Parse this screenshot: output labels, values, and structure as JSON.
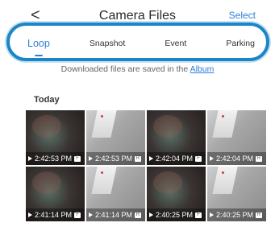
{
  "header": {
    "back_glyph": "<",
    "title": "Camera Files",
    "select_label": "Select"
  },
  "tabs": [
    {
      "label": "Loop",
      "active": true
    },
    {
      "label": "Snapshot",
      "active": false
    },
    {
      "label": "Event",
      "active": false
    },
    {
      "label": "Parking",
      "active": false
    }
  ],
  "info": {
    "prefix": "Downloaded files are saved in the ",
    "link": "Album"
  },
  "section": {
    "title": "Today"
  },
  "thumbnails": [
    {
      "time": "2:42:53 PM",
      "badge": "F",
      "style": "dark"
    },
    {
      "time": "2:42:53 PM",
      "badge": "R",
      "style": "light"
    },
    {
      "time": "2:42:04 PM",
      "badge": "F",
      "style": "dark"
    },
    {
      "time": "2:42:04 PM",
      "badge": "R",
      "style": "light"
    },
    {
      "time": "2:41:14 PM",
      "badge": "F",
      "style": "dark"
    },
    {
      "time": "2:41:14 PM",
      "badge": "R",
      "style": "light"
    },
    {
      "time": "2:40:25 PM",
      "badge": "F",
      "style": "dark"
    },
    {
      "time": "2:40:25 PM",
      "badge": "R",
      "style": "light"
    }
  ],
  "colors": {
    "accent": "#2f7fd6",
    "highlight_ring": "#1a86c8"
  },
  "icons": {
    "back": "chevron-left-icon",
    "play": "play-icon"
  }
}
